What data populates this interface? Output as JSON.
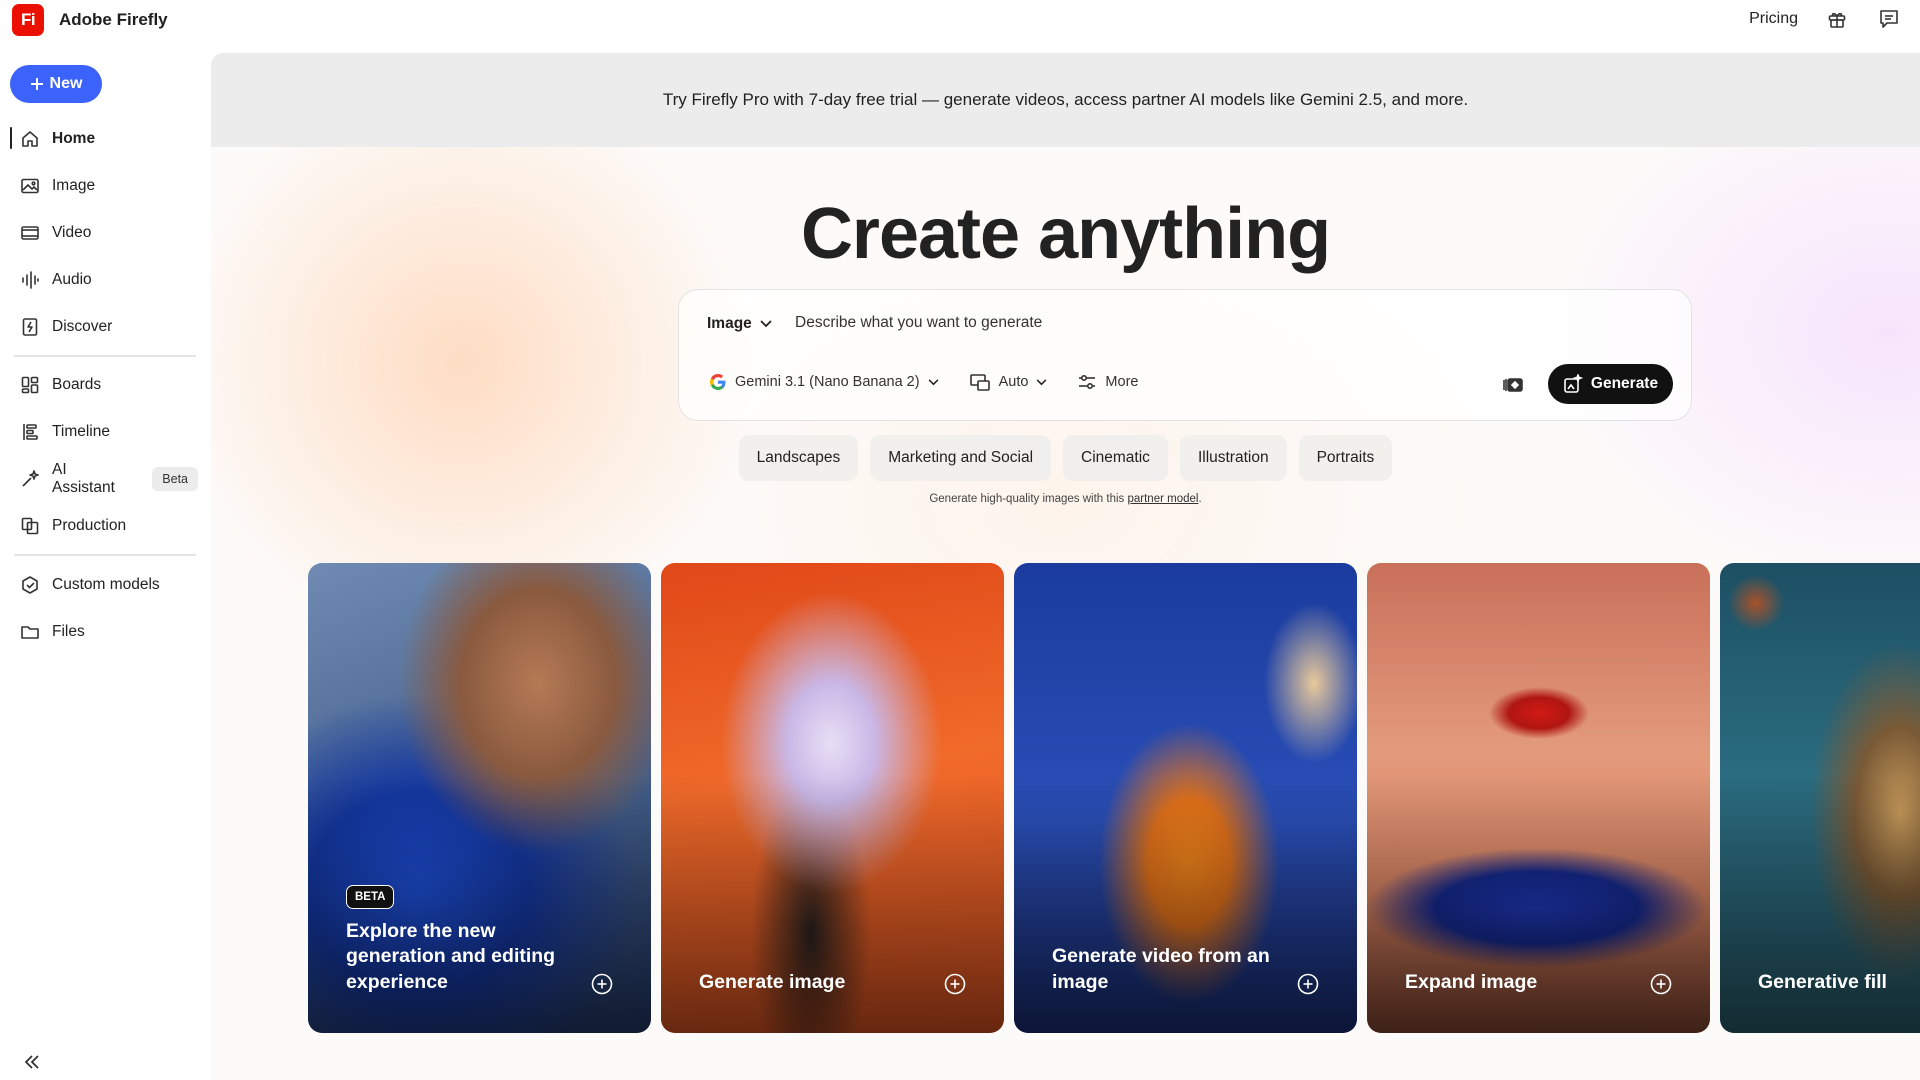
{
  "app": {
    "logo_text": "Fi",
    "title": "Adobe Firefly"
  },
  "header": {
    "pricing_label": "Pricing",
    "gift_icon": "gift-icon",
    "feedback_icon": "feedback-icon"
  },
  "sidebar": {
    "new_label": "New",
    "items": [
      {
        "label": "Home",
        "icon": "home-icon"
      },
      {
        "label": "Image",
        "icon": "image-icon"
      },
      {
        "label": "Video",
        "icon": "video-icon"
      },
      {
        "label": "Audio",
        "icon": "audio-icon"
      },
      {
        "label": "Discover",
        "icon": "discover-icon"
      },
      {
        "label": "Boards",
        "icon": "boards-icon"
      },
      {
        "label": "Timeline",
        "icon": "timeline-icon"
      },
      {
        "label": "AI Assistant",
        "icon": "ai-assistant-icon",
        "badge": "Beta"
      },
      {
        "label": "Production",
        "icon": "production-icon"
      },
      {
        "label": "Custom models",
        "icon": "custom-models-icon"
      },
      {
        "label": "Files",
        "icon": "folder-icon"
      }
    ]
  },
  "promo": {
    "text": "Try Firefly Pro with 7-day free trial — generate videos, access partner AI models like Gemini 2.5, and more."
  },
  "hero": {
    "title": "Create anything"
  },
  "prompt": {
    "type_label": "Image",
    "placeholder": "Describe what you want to generate",
    "model_label": "Gemini 3.1 (Nano Banana 2)",
    "aspect_label": "Auto",
    "more_label": "More",
    "generate_label": "Generate"
  },
  "chips": [
    "Landscapes",
    "Marketing and Social",
    "Cinematic",
    "Illustration",
    "Portraits"
  ],
  "note": {
    "text": "Generate high-quality images with this ",
    "link": "partner model",
    "suffix": "."
  },
  "cards": [
    {
      "title": "Explore the new generation and editing experience",
      "badge": "BETA"
    },
    {
      "title": "Generate image"
    },
    {
      "title": "Generate video from an image"
    },
    {
      "title": "Expand image"
    },
    {
      "title": "Generative fill"
    }
  ],
  "colors": {
    "brand": "#eb1000",
    "new_button": "#3b63fb",
    "generate_button": "#111111"
  }
}
